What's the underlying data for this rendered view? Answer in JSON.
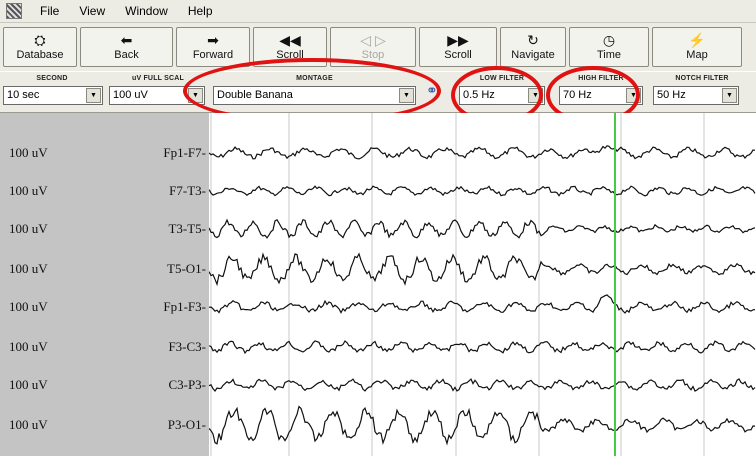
{
  "menu": [
    "File",
    "View",
    "Window",
    "Help"
  ],
  "toolbar": [
    {
      "label": "Database",
      "icon": "database-icon",
      "glyph": "⛭",
      "enabled": true
    },
    {
      "label": "Back",
      "icon": "back-arrow-icon",
      "glyph": "⬅",
      "enabled": true
    },
    {
      "label": "Forward",
      "icon": "forward-arrow-icon",
      "glyph": "➡",
      "enabled": true
    },
    {
      "label": "Scroll",
      "icon": "scroll-back-icon",
      "glyph": "◀◀",
      "enabled": true
    },
    {
      "label": "Stop",
      "icon": "stop-icon",
      "glyph": "◁ ▷",
      "enabled": false
    },
    {
      "label": "Scroll",
      "icon": "scroll-forward-icon",
      "glyph": "▶▶",
      "enabled": true
    },
    {
      "label": "Navigate",
      "icon": "navigate-icon",
      "glyph": "↻",
      "enabled": true
    },
    {
      "label": "Time",
      "icon": "clock-icon",
      "glyph": "◷",
      "enabled": true
    },
    {
      "label": "Map",
      "icon": "map-icon",
      "glyph": "⚡",
      "enabled": true
    }
  ],
  "controls": {
    "second": {
      "label": "SECOND",
      "value": "10 sec"
    },
    "uv_full_scale": {
      "label": "uV FULL SCAL",
      "value": "100 uV"
    },
    "montage": {
      "label": "MONTAGE",
      "value": "Double Banana"
    },
    "low_filter": {
      "label": "LOW FILTER",
      "value": "0.5 Hz"
    },
    "high_filter": {
      "label": "HIGH FILTER",
      "value": "70 Hz"
    },
    "notch_filter": {
      "label": "NOTCH FILTER",
      "value": "50 Hz"
    }
  },
  "channels": [
    {
      "scale": "100 uV",
      "name": "Fp1-F7"
    },
    {
      "scale": "100 uV",
      "name": "F7-T3"
    },
    {
      "scale": "100 uV",
      "name": "T3-T5"
    },
    {
      "scale": "100 uV",
      "name": "T5-O1"
    },
    {
      "scale": "100 uV",
      "name": "Fp1-F3"
    },
    {
      "scale": "100 uV",
      "name": "F3-C3"
    },
    {
      "scale": "100 uV",
      "name": "C3-P3"
    },
    {
      "scale": "100 uV",
      "name": "P3-O1"
    }
  ],
  "colors": {
    "trace": "#111111",
    "cursor": "#44cc44",
    "highlight": "#e01212",
    "grid": "#c8c8c8"
  }
}
